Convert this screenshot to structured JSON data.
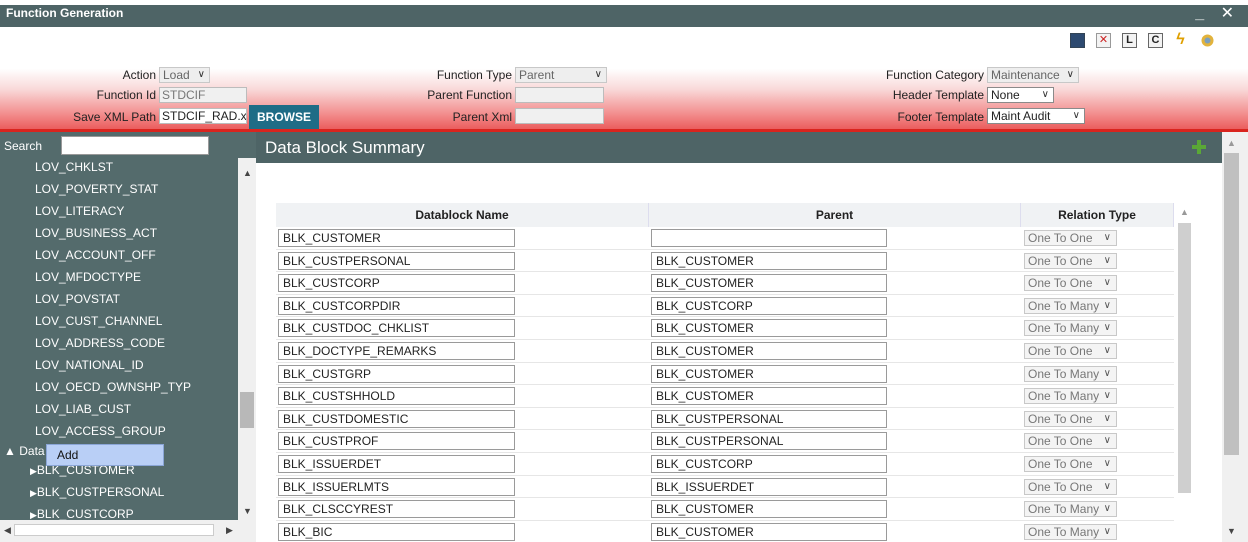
{
  "window": {
    "title": "Function Generation",
    "controls": "_ ✕"
  },
  "toolbar": {
    "icons": [
      "save-icon",
      "close-icon",
      "L-icon",
      "C-icon",
      "generate-icon",
      "release-icon"
    ],
    "L": "L",
    "C": "C"
  },
  "header": {
    "action_label": "Action",
    "action_value": "Load",
    "function_id_label": "Function Id",
    "function_id_value": "STDCIF",
    "save_xml_label": "Save XML Path",
    "save_xml_value": "STDCIF_RAD.xml",
    "browse_label": "BROWSE",
    "function_type_label": "Function Type",
    "function_type_value": "Parent",
    "parent_function_label": "Parent Function",
    "parent_function_value": "",
    "parent_xml_label": "Parent Xml",
    "parent_xml_value": "",
    "function_category_label": "Function Category",
    "function_category_value": "Maintenance",
    "header_template_label": "Header Template",
    "header_template_value": "None",
    "footer_template_label": "Footer Template",
    "footer_template_value": "Maint Audit"
  },
  "sidebar": {
    "search_label": "Search",
    "items": [
      "LOV_CHKLST",
      "LOV_POVERTY_STAT",
      "LOV_LITERACY",
      "LOV_BUSINESS_ACT",
      "LOV_ACCOUNT_OFF",
      "LOV_MFDOCTYPE",
      "LOV_POVSTAT",
      "LOV_CUST_CHANNEL",
      "LOV_ADDRESS_CODE",
      "LOV_NATIONAL_ID",
      "LOV_OECD_OWNSHP_TYP",
      "LOV_LIAB_CUST",
      "LOV_ACCESS_GROUP"
    ],
    "datablocks_node": "Data",
    "children": [
      "BLK_CUSTOMER",
      "BLK_CUSTPERSONAL",
      "BLK_CUSTCORP"
    ],
    "context_menu": "Add"
  },
  "main": {
    "title": "Data Block Summary",
    "columns": [
      "Datablock Name",
      "Parent",
      "Relation Type"
    ],
    "rows": [
      {
        "name": "BLK_CUSTOMER",
        "parent": "",
        "rel": "One To One"
      },
      {
        "name": "BLK_CUSTPERSONAL",
        "parent": "BLK_CUSTOMER",
        "rel": "One To One"
      },
      {
        "name": "BLK_CUSTCORP",
        "parent": "BLK_CUSTOMER",
        "rel": "One To One"
      },
      {
        "name": "BLK_CUSTCORPDIR",
        "parent": "BLK_CUSTCORP",
        "rel": "One To Many"
      },
      {
        "name": "BLK_CUSTDOC_CHKLIST",
        "parent": "BLK_CUSTOMER",
        "rel": "One To Many"
      },
      {
        "name": "BLK_DOCTYPE_REMARKS",
        "parent": "BLK_CUSTOMER",
        "rel": "One To One"
      },
      {
        "name": "BLK_CUSTGRP",
        "parent": "BLK_CUSTOMER",
        "rel": "One To Many"
      },
      {
        "name": "BLK_CUSTSHHOLD",
        "parent": "BLK_CUSTOMER",
        "rel": "One To Many"
      },
      {
        "name": "BLK_CUSTDOMESTIC",
        "parent": "BLK_CUSTPERSONAL",
        "rel": "One To One"
      },
      {
        "name": "BLK_CUSTPROF",
        "parent": "BLK_CUSTPERSONAL",
        "rel": "One To One"
      },
      {
        "name": "BLK_ISSUERDET",
        "parent": "BLK_CUSTCORP",
        "rel": "One To One"
      },
      {
        "name": "BLK_ISSUERLMTS",
        "parent": "BLK_ISSUERDET",
        "rel": "One To One"
      },
      {
        "name": "BLK_CLSCCYREST",
        "parent": "BLK_CUSTOMER",
        "rel": "One To Many"
      },
      {
        "name": "BLK_BIC",
        "parent": "BLK_CUSTOMER",
        "rel": "One To Many"
      }
    ]
  },
  "colors": {
    "title_bar": "#4e6466",
    "accent_red": "#d9241e",
    "browse": "#1f6c86",
    "add_green": "#5aa836"
  }
}
